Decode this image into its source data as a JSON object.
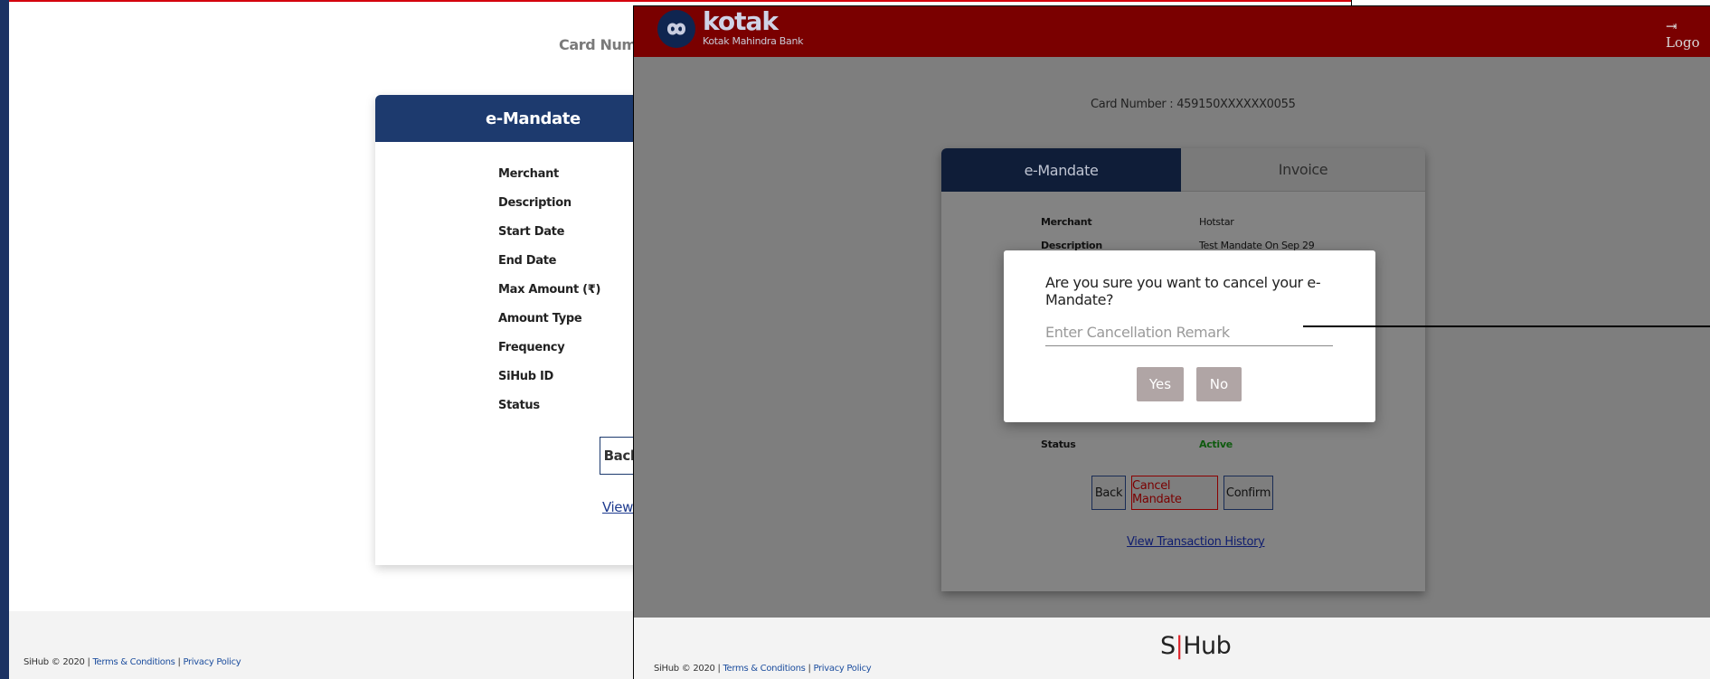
{
  "background_page": {
    "card_number_label": "Card Numbe",
    "card_title": "e-Mandate",
    "labels": [
      "Merchant",
      "Description",
      "Start Date",
      "End Date",
      "Max Amount (₹)",
      "Amount Type",
      "Frequency",
      "SiHub ID",
      "Status"
    ],
    "back_label": "Back",
    "view_link": "View T",
    "footer": {
      "brand": "SiHub",
      "copyright": "2020",
      "sep1": "|",
      "terms": "Terms & Conditions",
      "sep2": "|",
      "privacy": "Privacy Policy"
    }
  },
  "foreground_page": {
    "header": {
      "brand_wordmark": "kotak",
      "brand_subtitle": "Kotak Mahindra Bank",
      "logout_label": "Logo"
    },
    "card_number": "Card Number : 459150XXXXXX0055",
    "tabs": [
      {
        "label": "e-Mandate",
        "active": true
      },
      {
        "label": "Invoice",
        "active": false
      }
    ],
    "details": [
      {
        "label": "Merchant",
        "value": "Hotstar"
      },
      {
        "label": "Description",
        "value": "Test Mandate On Sep 29"
      }
    ],
    "status": {
      "label": "Status",
      "value": "Active"
    },
    "buttons": {
      "back": "Back",
      "cancel_mandate": "Cancel Mandate",
      "confirm": "Confirm"
    },
    "view_history_link": "View Transaction History",
    "footer": {
      "brand": "SiHub",
      "copyright": "2020",
      "sep1": "|",
      "terms": "Terms & Conditions",
      "sep2": "|",
      "privacy": "Privacy Policy"
    },
    "sihub_logo": {
      "left": "S",
      "pipe": "|",
      "right": "Hub"
    }
  },
  "modal": {
    "question": "Are you sure you want to cancel your e-Mandate?",
    "remark_placeholder": "Enter Cancellation Remark",
    "remark_value": "",
    "yes_label": "Yes",
    "no_label": "No"
  },
  "colors": {
    "kotak_red": "#7a0000",
    "navy": "#1d3a6e",
    "status_active": "#0e5a0e",
    "sihub_accent": "#e0282e"
  }
}
